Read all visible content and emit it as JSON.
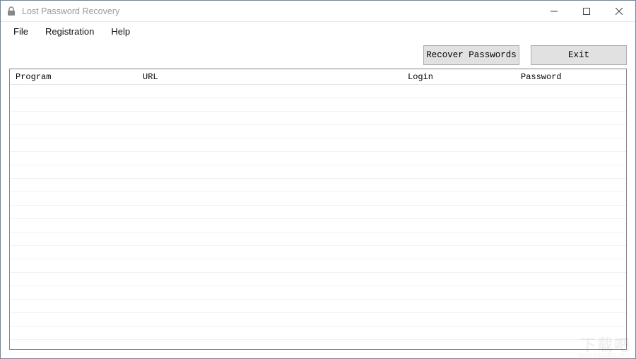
{
  "window": {
    "title": "Lost Password Recovery"
  },
  "menu": {
    "file": "File",
    "registration": "Registration",
    "help": "Help"
  },
  "toolbar": {
    "recover_label": "Recover Passwords",
    "exit_label": "Exit"
  },
  "grid": {
    "columns": {
      "program": "Program",
      "url": "URL",
      "login": "Login",
      "password": "Password"
    },
    "rows": []
  },
  "watermark": {
    "main": "下载吧",
    "sub": "www.xiazaiba.com"
  }
}
